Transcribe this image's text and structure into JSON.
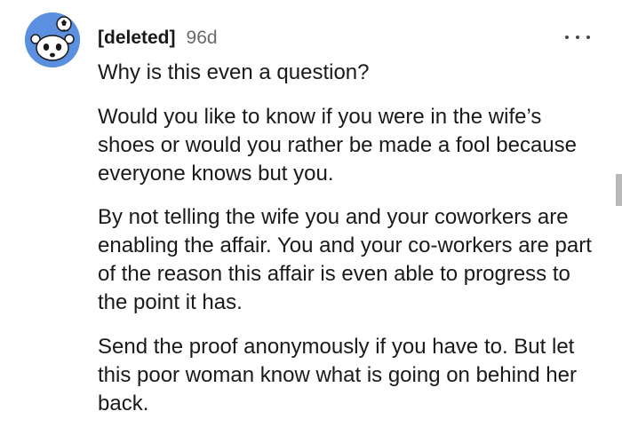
{
  "comment": {
    "author": "[deleted]",
    "age": "96d",
    "paragraphs": [
      "Why is this even a question?",
      "Would you like to know if you were in the wife’s shoes or would you rather be made a fool because everyone knows but you.",
      "By not telling the wife you and your coworkers are enabling the affair. You and your co-workers are part of the reason this affair is even able to progress to the point it has.",
      "Send the proof anonymously if you have to. But let this poor woman know what is going on behind her back."
    ],
    "avatar_icon": "snoo-avatar-icon",
    "menu_icon": "more-options-icon"
  },
  "colors": {
    "avatar_bg": "#5b8fe0",
    "text": "#1a1a1b",
    "muted": "#6a6a6a"
  }
}
